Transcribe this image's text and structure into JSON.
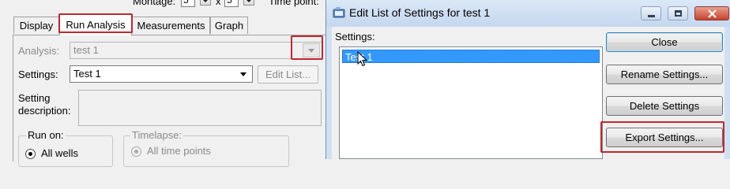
{
  "topstrip": {
    "montage_label": "Montage:",
    "montage_x_value": "5",
    "x_label": "x",
    "montage_y_value": "5",
    "timepoint_label": "Time point:"
  },
  "tabs": [
    {
      "label": "Display",
      "active": false
    },
    {
      "label": "Run Analysis",
      "active": true
    },
    {
      "label": "Measurements",
      "active": false
    },
    {
      "label": "Graph",
      "active": false
    }
  ],
  "run_analysis": {
    "analysis_label": "Analysis:",
    "analysis_value": "test 1",
    "settings_label": "Settings:",
    "settings_value": "Test 1",
    "edit_list_label": "Edit List...",
    "setting_description_label": "Setting\ndescription:",
    "run_on_label": "Run on:",
    "all_wells_label": "All wells",
    "timelapse_label": "Timelapse:",
    "all_time_points_label": "All time points"
  },
  "dialog": {
    "title": "Edit List of Settings for test 1",
    "settings_label": "Settings:",
    "settings_items": [
      "Test 1"
    ],
    "selected_index": 0,
    "buttons": {
      "close": "Close",
      "rename": "Rename Settings...",
      "delete": "Delete Settings",
      "export": "Export Settings..."
    },
    "minimize_icon": "minimize-icon",
    "maximize_icon": "maximize-icon",
    "close_icon": "close-icon"
  },
  "colors": {
    "highlight": "#c0282e",
    "selection": "#3399ff",
    "dialog_frame": "#cfe0f3"
  }
}
